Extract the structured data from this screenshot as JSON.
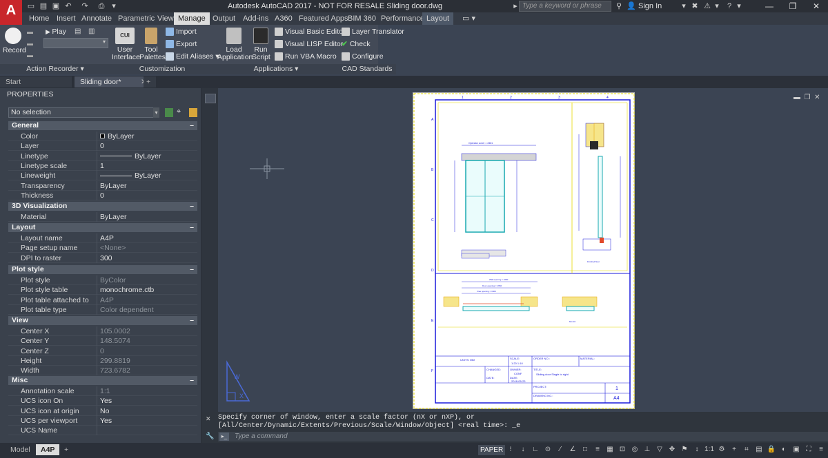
{
  "app": {
    "title": "Autodesk AutoCAD 2017 - NOT FOR RESALE   Sliding door.dwg",
    "search_placeholder": "Type a keyword or phrase",
    "sign_in": "Sign In"
  },
  "ribbon_tabs": [
    "Home",
    "Insert",
    "Annotate",
    "Parametric",
    "View",
    "Manage",
    "Output",
    "Add-ins",
    "A360",
    "Featured Apps",
    "BIM 360",
    "Performance",
    "Layout"
  ],
  "active_tab": "Manage",
  "ribbon": {
    "record": "Record",
    "play": "Play",
    "action_recorder": "Action Recorder",
    "user_interface": "User\nInterface",
    "user_interface_a": "User",
    "user_interface_b": "Interface",
    "tool_palettes_a": "Tool",
    "tool_palettes_b": "Palettes",
    "import": "Import",
    "export": "Export",
    "edit_aliases": "Edit Aliases",
    "customization": "Customization",
    "load_app_a": "Load",
    "load_app_b": "Application",
    "run_script_a": "Run",
    "run_script_b": "Script",
    "vba_editor": "Visual Basic Editor",
    "lisp_editor": "Visual LISP Editor",
    "run_vba": "Run VBA Macro",
    "applications": "Applications",
    "layer_translator": "Layer Translator",
    "check": "Check",
    "configure": "Configure",
    "cad_standards": "CAD Standards",
    "cui_label": "CUI"
  },
  "doc_tabs": {
    "start": "Start",
    "current": "Sliding door*",
    "plus": "+"
  },
  "properties": {
    "title": "PROPERTIES",
    "selection": "No selection",
    "sections": {
      "general": "General",
      "viz3d": "3D Visualization",
      "layout": "Layout",
      "plot": "Plot style",
      "view": "View",
      "misc": "Misc"
    },
    "general": [
      {
        "k": "Color",
        "v": "ByLayer"
      },
      {
        "k": "Layer",
        "v": "0"
      },
      {
        "k": "Linetype",
        "v": "ByLayer"
      },
      {
        "k": "Linetype scale",
        "v": "1"
      },
      {
        "k": "Lineweight",
        "v": "ByLayer"
      },
      {
        "k": "Transparency",
        "v": "ByLayer"
      },
      {
        "k": "Thickness",
        "v": "0"
      }
    ],
    "viz3d": [
      {
        "k": "Material",
        "v": "ByLayer"
      }
    ],
    "layout": [
      {
        "k": "Layout name",
        "v": "A4P"
      },
      {
        "k": "Page setup name",
        "v": "<None>"
      },
      {
        "k": "DPI to raster",
        "v": "300"
      }
    ],
    "plot": [
      {
        "k": "Plot style",
        "v": "ByColor"
      },
      {
        "k": "Plot style table",
        "v": "monochrome.ctb"
      },
      {
        "k": "Plot table attached to",
        "v": "A4P"
      },
      {
        "k": "Plot table type",
        "v": "Color dependent"
      }
    ],
    "view": [
      {
        "k": "Center X",
        "v": "105.0002"
      },
      {
        "k": "Center Y",
        "v": "148.5074"
      },
      {
        "k": "Center Z",
        "v": "0"
      },
      {
        "k": "Height",
        "v": "299.8819"
      },
      {
        "k": "Width",
        "v": "723.6782"
      }
    ],
    "misc": [
      {
        "k": "Annotation scale",
        "v": "1:1"
      },
      {
        "k": "UCS icon On",
        "v": "Yes"
      },
      {
        "k": "UCS icon at origin",
        "v": "No"
      },
      {
        "k": "UCS per viewport",
        "v": "Yes"
      },
      {
        "k": "UCS Name",
        "v": ""
      }
    ]
  },
  "command": {
    "line1": "Specify corner of window, enter a scale factor (nX or nXP), or",
    "line2": "[All/Center/Dynamic/Extents/Previous/Scale/Window/Object] <real time>: _e",
    "placeholder": "Type a command"
  },
  "status": {
    "model": "Model",
    "layout": "A4P",
    "plus": "+",
    "paper": "PAPER"
  },
  "drawing": {
    "units": "UNITS: MM",
    "scale_label": "SCALE:",
    "scale": "1:20 1:10",
    "order_no": "ORDER NO.:",
    "material": "MATERIAL:",
    "changed": "CHANGED:",
    "owner_label": "OWNER:",
    "owner": "CONF",
    "title_label": "TITLE:",
    "title": "Sliding door Single to right",
    "date_label": "DATE:",
    "date_label2": "DATE:",
    "date": "2018-05-23",
    "project": "PROJECT:",
    "drawing_no": "DRAWING NO.:",
    "sheet": "1",
    "size": "A4",
    "operator_cover": "Operator cover = 2461",
    "wall_opening": "Wall opening = 1600",
    "door_opening": "Door opening = 1650",
    "free_opening": "Free opening = 1500",
    "min20": "Min 20",
    "floor_note": "Finished floor",
    "cols": [
      "1",
      "2",
      "3",
      "4"
    ],
    "rows": [
      "A",
      "B",
      "C",
      "D",
      "E",
      "F"
    ]
  }
}
